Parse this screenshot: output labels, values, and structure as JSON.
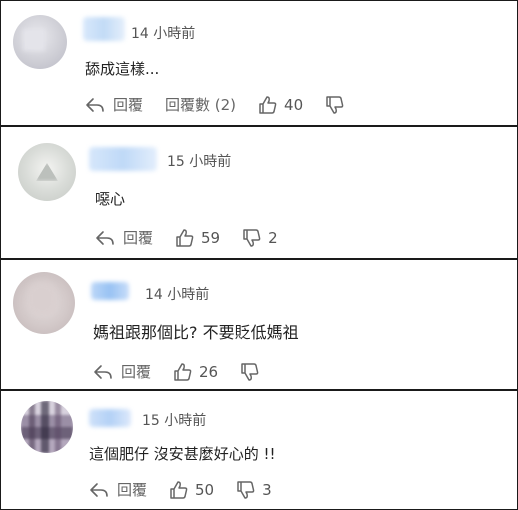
{
  "comments": [
    {
      "timestamp": "14 小時前",
      "text": "舔成這樣...",
      "reply_label": "回覆",
      "replies_label": "回覆數 (2)",
      "likes": "40",
      "dislikes": ""
    },
    {
      "timestamp": "15 小時前",
      "text": "噁心",
      "reply_label": "回覆",
      "likes": "59",
      "dislikes": "2"
    },
    {
      "timestamp": "14 小時前",
      "text": "媽祖跟那個比? 不要貶低媽祖",
      "reply_label": "回覆",
      "likes": "26",
      "dislikes": ""
    },
    {
      "timestamp": "15 小時前",
      "text": "這個肥仔 沒安甚麼好心的 !!",
      "reply_label": "回覆",
      "likes": "50",
      "dislikes": "3"
    }
  ],
  "icons": {
    "reply": "reply-arrow-icon",
    "like": "thumbs-up-icon",
    "dislike": "thumbs-down-icon"
  },
  "colors": {
    "border": "#1a1a1a",
    "text": "#222222",
    "muted": "#666666"
  }
}
